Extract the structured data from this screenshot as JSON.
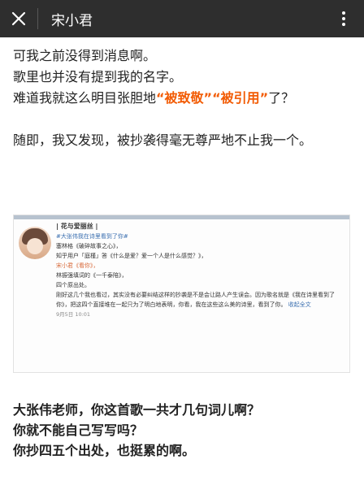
{
  "header": {
    "title": "宋小君"
  },
  "article": {
    "line1": "可我之前没得到消息啊。",
    "line2": "歌里也并没有提到我的名字。",
    "line3_pre": "难道我就这么明目张胆地",
    "line3_hl1": "“被致敬”",
    "line3_hl2": "“被引用”",
    "line3_post": "了？",
    "para2": "随即，我又发现，被抄袭得毫无尊严地不止我一个。"
  },
  "embedded_post": {
    "user": "| 花与爱丽丝 |",
    "tag": "#大张伟我在诗里看到了你#",
    "lines": [
      "塞林格《破碎故事之心》，",
      "知乎用户「庭槿」答《什么是爱？爱一个人是什么感觉？》，",
      "宋小君《看你》，",
      "林振强填词的《一千泰陪》，",
      "四个原出处。"
    ],
    "body": "刚好这几个我也看过，其实没有必要纠结这样的抄袭是不是会让路人产生误会。因为歌名就是《我在诗里看到了你》，把这四个直接堆在一起只为了明白地表明，你看，我在这些这么美的诗里，看到了你。",
    "expand": "收起全文",
    "time": "9月5日 10:01"
  },
  "bottom": {
    "line1": "大张伟老师，你这首歌一共才几句词儿啊？",
    "line2": "你就不能自己写写吗？",
    "line3": "你抄四五个出处，也挺累的啊。"
  },
  "icons": {
    "close": "close-icon",
    "more": "more-vertical-icon"
  },
  "colors": {
    "topbar": "#2e2e2e",
    "highlight": "#f25c05",
    "link": "#3a6fb0"
  }
}
